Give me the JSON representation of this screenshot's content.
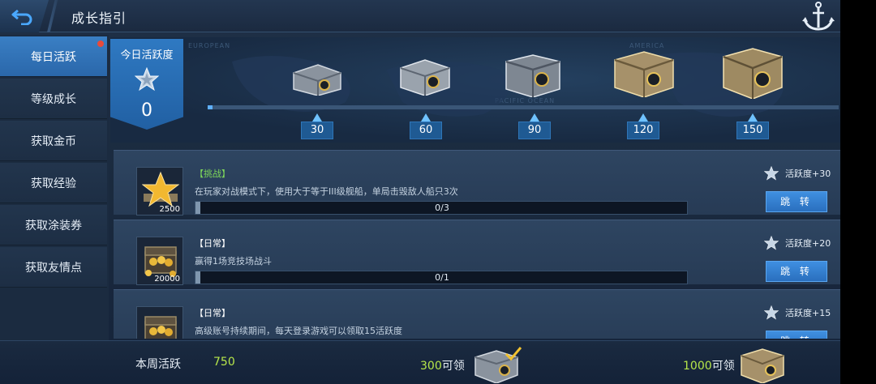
{
  "header": {
    "title": "成长指引"
  },
  "sidebar": {
    "items": [
      {
        "label": "每日活跃",
        "active": true,
        "badge": true
      },
      {
        "label": "等级成长"
      },
      {
        "label": "获取金币"
      },
      {
        "label": "获取经验"
      },
      {
        "label": "获取涂装券"
      },
      {
        "label": "获取友情点"
      }
    ]
  },
  "activity": {
    "label": "今日活跃度",
    "value": "0",
    "progress": 0,
    "map_labels": [
      "EUROPEAN",
      "AMERICA",
      "PACIFIC OCEAN"
    ],
    "milestones": [
      "30",
      "60",
      "90",
      "120",
      "150"
    ]
  },
  "tasks": [
    {
      "tag": "【挑战】",
      "tag_color": "#7ed85a",
      "desc": "在玩家对战模式下，使用大于等于III级舰船，单局击毁敌人船只3次",
      "progress": "0/3",
      "points": "活跃度+30",
      "button": "跳 转",
      "reward": "2500",
      "icon": "star-medal-icon"
    },
    {
      "tag": "【日常】",
      "tag_color": "#ffffff",
      "desc": "赢得1场竞技场战斗",
      "progress": "0/1",
      "points": "活跃度+20",
      "button": "跳 转",
      "reward": "20000",
      "icon": "gold-chest-icon"
    },
    {
      "tag": "【日常】",
      "tag_color": "#ffffff",
      "desc": "高级账号持续期间，每天登录游戏可以领取15活跃度",
      "progress": "",
      "points": "活跃度+15",
      "button": "跳 转",
      "reward": "",
      "icon": "gold-chest-icon"
    }
  ],
  "footer": {
    "weekly_label": "本周活跃",
    "weekly_value": "750",
    "reward1_num": "300",
    "reward1_suffix": "可领",
    "reward2_num": "1000",
    "reward2_suffix": "可领"
  },
  "colors": {
    "accent": "#2f79c2",
    "highlight": "#b6e64a",
    "challenge": "#7ed85a"
  }
}
